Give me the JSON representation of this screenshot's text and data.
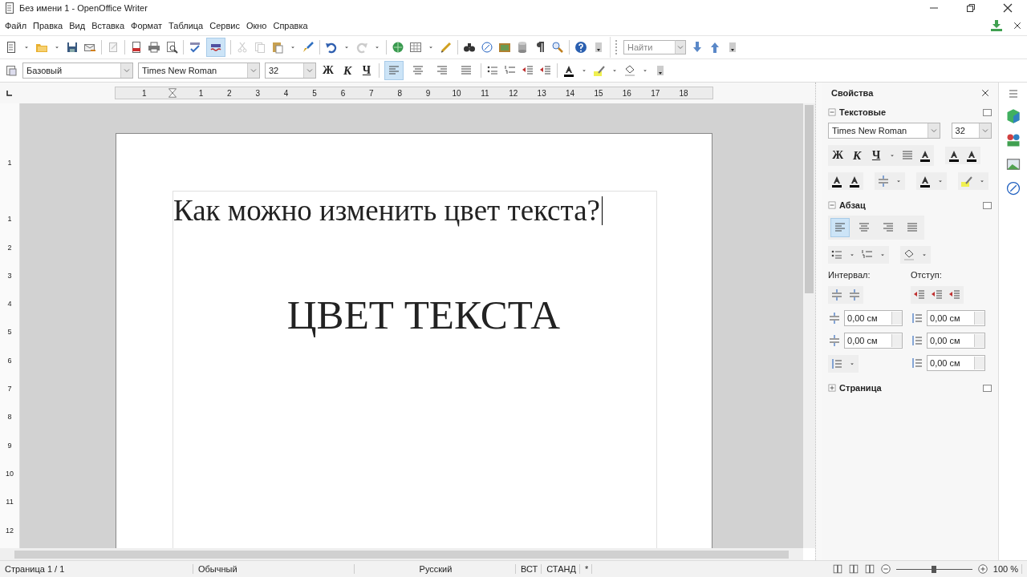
{
  "window": {
    "title": "Без имени 1 - OpenOffice Writer"
  },
  "menu": [
    {
      "label": "Файл"
    },
    {
      "label": "Правка"
    },
    {
      "label": "Вид"
    },
    {
      "label": "Вставка"
    },
    {
      "label": "Формат"
    },
    {
      "label": "Таблица"
    },
    {
      "label": "Сервис"
    },
    {
      "label": "Окно"
    },
    {
      "label": "Справка"
    }
  ],
  "toolbar": {
    "autospell_on": true,
    "find_placeholder": "Найти"
  },
  "formatting": {
    "style": "Базовый",
    "font": "Times New Roman",
    "size": "32",
    "bold": "Ж",
    "italic": "К",
    "underline": "Ч",
    "align": [
      {
        "selected": true
      },
      {
        "selected": false
      },
      {
        "selected": false
      },
      {
        "selected": false
      }
    ]
  },
  "ruler": {
    "horizontal_labels": [
      "1",
      "1",
      "2",
      "3",
      "4",
      "5",
      "6",
      "7",
      "8",
      "9",
      "10",
      "11",
      "12",
      "13",
      "14",
      "15",
      "16",
      "17",
      "18"
    ],
    "vertical_labels": [
      "1",
      "1",
      "2",
      "3",
      "4",
      "5",
      "6",
      "7",
      "8",
      "9",
      "10",
      "11",
      "12"
    ]
  },
  "document": {
    "paragraphs": [
      {
        "kind": "text",
        "text": "Как можно изменить цвет текста?"
      },
      {
        "kind": "heading",
        "text": "ЦВЕТ ТЕКСТА"
      }
    ]
  },
  "sidebar": {
    "title": "Свойства",
    "text_section": {
      "title": "Текстовые",
      "expanded": true,
      "font": "Times New Roman",
      "size": "32",
      "bold": "Ж",
      "italic": "К",
      "underline": "Ч"
    },
    "paragraph_section": {
      "title": "Абзац",
      "expanded": true,
      "align": [
        {
          "selected": true
        },
        {
          "selected": false
        },
        {
          "selected": false
        },
        {
          "selected": false
        }
      ],
      "spacing_label": "Интервал:",
      "indent_label": "Отступ:",
      "spacing_fields": [
        "0,00 см",
        "0,00 см"
      ],
      "indent_fields": [
        "0,00 см",
        "0,00 см",
        "0,00 см"
      ]
    },
    "page_section": {
      "title": "Страница",
      "expanded": false
    }
  },
  "status_bar": {
    "page": "Страница 1 / 1",
    "style": "Обычный",
    "language": "Русский",
    "insert_mode": "ВСТ",
    "selection_mode": "СТАНД",
    "modified": "*",
    "zoom": "100 %",
    "zoom_level": {
      "level": 0.5
    }
  }
}
